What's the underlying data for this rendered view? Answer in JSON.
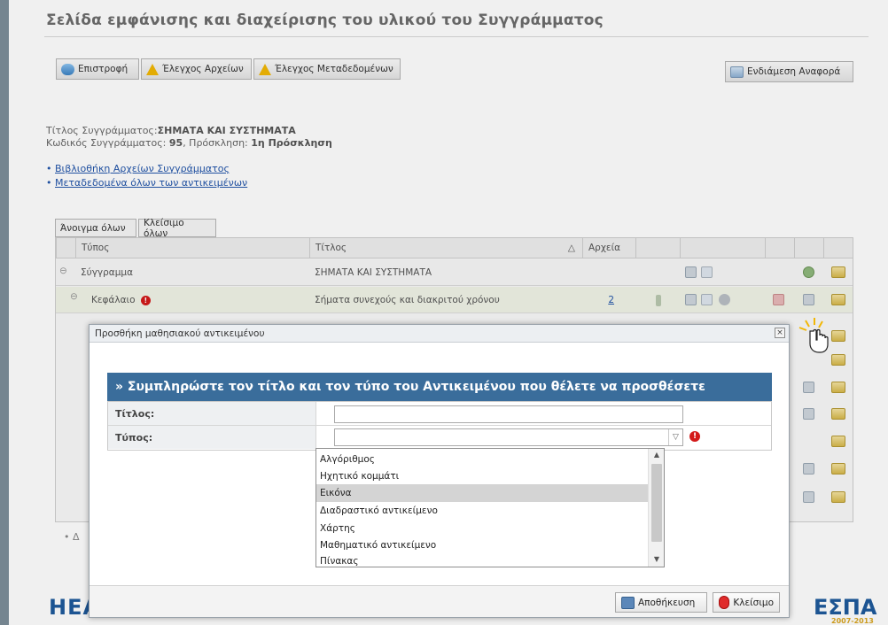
{
  "page": {
    "title": "Σελίδα εμφάνισης και διαχείρισης του υλικού του Συγγράμματος"
  },
  "toolbar": {
    "back_label": "Επιστροφή",
    "file_check_label": "Έλεγχος Αρχείων",
    "metadata_check_label": "Έλεγχος Μεταδεδομένων",
    "report_label": "Ενδιάμεση Αναφορά"
  },
  "book_info": {
    "title_label": "Τίτλος Συγγράμματος:",
    "title_value": "ΣΗΜΑΤΑ ΚΑΙ ΣΥΣΤΗΜΑΤΑ",
    "code_label": "Κωδικός Συγγράμματος:",
    "code_value": "95",
    "call_label": ", Πρόσκληση:",
    "call_value": "1η Πρόσκληση"
  },
  "links": {
    "library": "Βιβλιοθήκη Αρχείων Συγγράμματος",
    "metadata": "Μεταδεδομένα όλων των αντικειμένων"
  },
  "tree_controls": {
    "open_all": "Άνοιγμα όλων",
    "close_all": "Κλείσιμο όλων"
  },
  "table": {
    "headers": {
      "type": "Τύπος",
      "title": "Τίτλος",
      "sort_mark": "△",
      "files": "Αρχεία"
    },
    "rows": [
      {
        "type": "Σύγγραμμα",
        "title": "ΣΗΜΑΤΑ ΚΑΙ ΣΥΣΤΗΜΑΤΑ",
        "files": ""
      },
      {
        "type": "Κεφάλαιο",
        "title": "Σήματα συνεχούς και διακριτού χρόνου",
        "files": "2"
      }
    ]
  },
  "dialog": {
    "title": "Προσθήκη μαθησιακού αντικειμένου",
    "close_glyph": "×",
    "form_heading": "» Συμπληρώστε τον τίτλο και τον τύπο του Αντικειμένου που θέλετε να προσθέσετε",
    "title_label": "Τίτλος:",
    "title_value": "",
    "type_label": "Τύπος:",
    "type_value": "",
    "required_mark": "!",
    "options": [
      "Αλγόριθμος",
      "Ηχητικό κομμάτι",
      "Εικόνα",
      "Διαδραστικό αντικείμενο",
      "Χάρτης",
      "Μαθηματικό αντικείμενο",
      "Πίνακας"
    ],
    "highlighted_option": "Εικόνα",
    "save_label": "Αποθήκευση",
    "close_label": "Κλείσιμο"
  },
  "footer": {
    "logo_left": "HEA",
    "logo_right": "ΕΣΠΑ",
    "logo_right_years": "2007-2013"
  },
  "partial_bullet": "Δ",
  "colors": {
    "form_heading_bg": "#3a6d9b",
    "link": "#2255aa",
    "required": "#d31a1a",
    "left_bar": "#7d8e99"
  }
}
